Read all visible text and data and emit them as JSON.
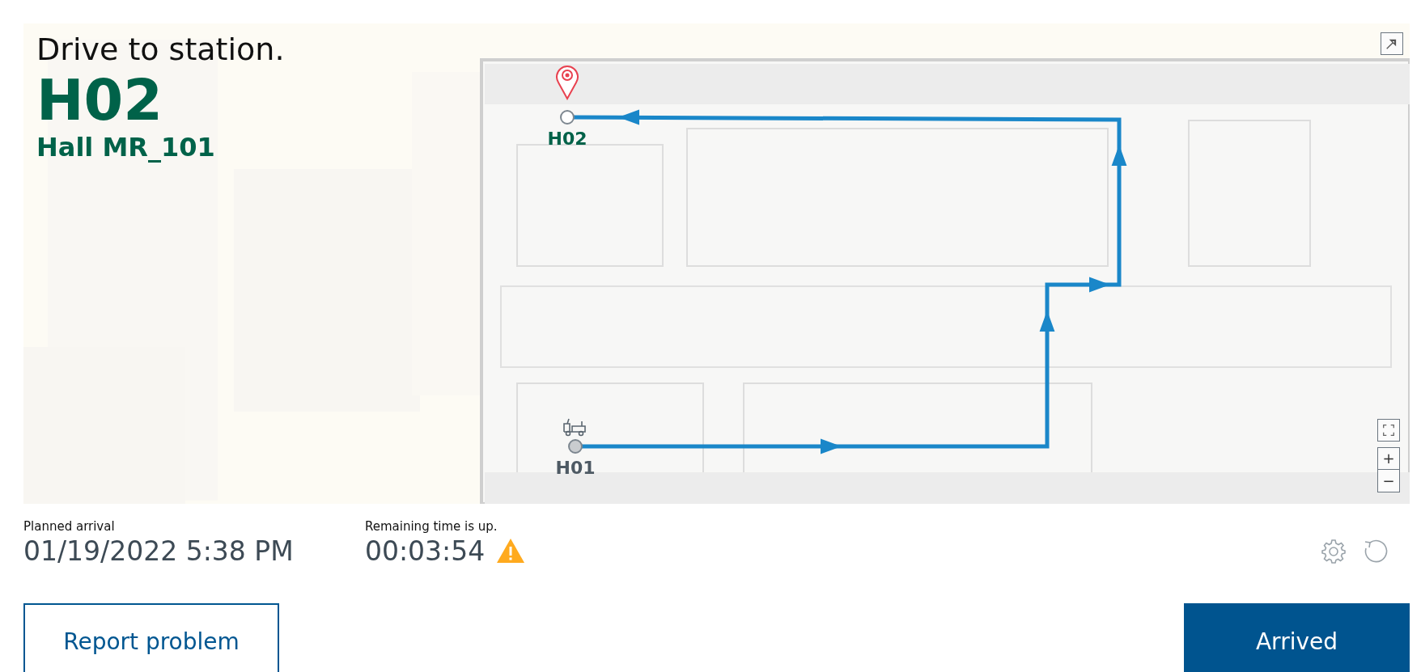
{
  "map": {
    "instruction": "Drive to station.",
    "station": "H02",
    "hall": "Hall MR_101",
    "markers": [
      {
        "kind": "destination",
        "label": "H02"
      },
      {
        "kind": "start",
        "label": "H01"
      }
    ],
    "zoom_in": "+",
    "zoom_out": "−"
  },
  "planned_arrival": {
    "label": "Planned arrival",
    "value": "01/19/2022 5:38 PM"
  },
  "remaining": {
    "label": "Remaining time is up.",
    "value": "00:03:54",
    "warning": true
  },
  "buttons": [
    {
      "label": "Report problem",
      "kind": "secondary"
    },
    {
      "label": "Arrived",
      "kind": "primary"
    }
  ]
}
